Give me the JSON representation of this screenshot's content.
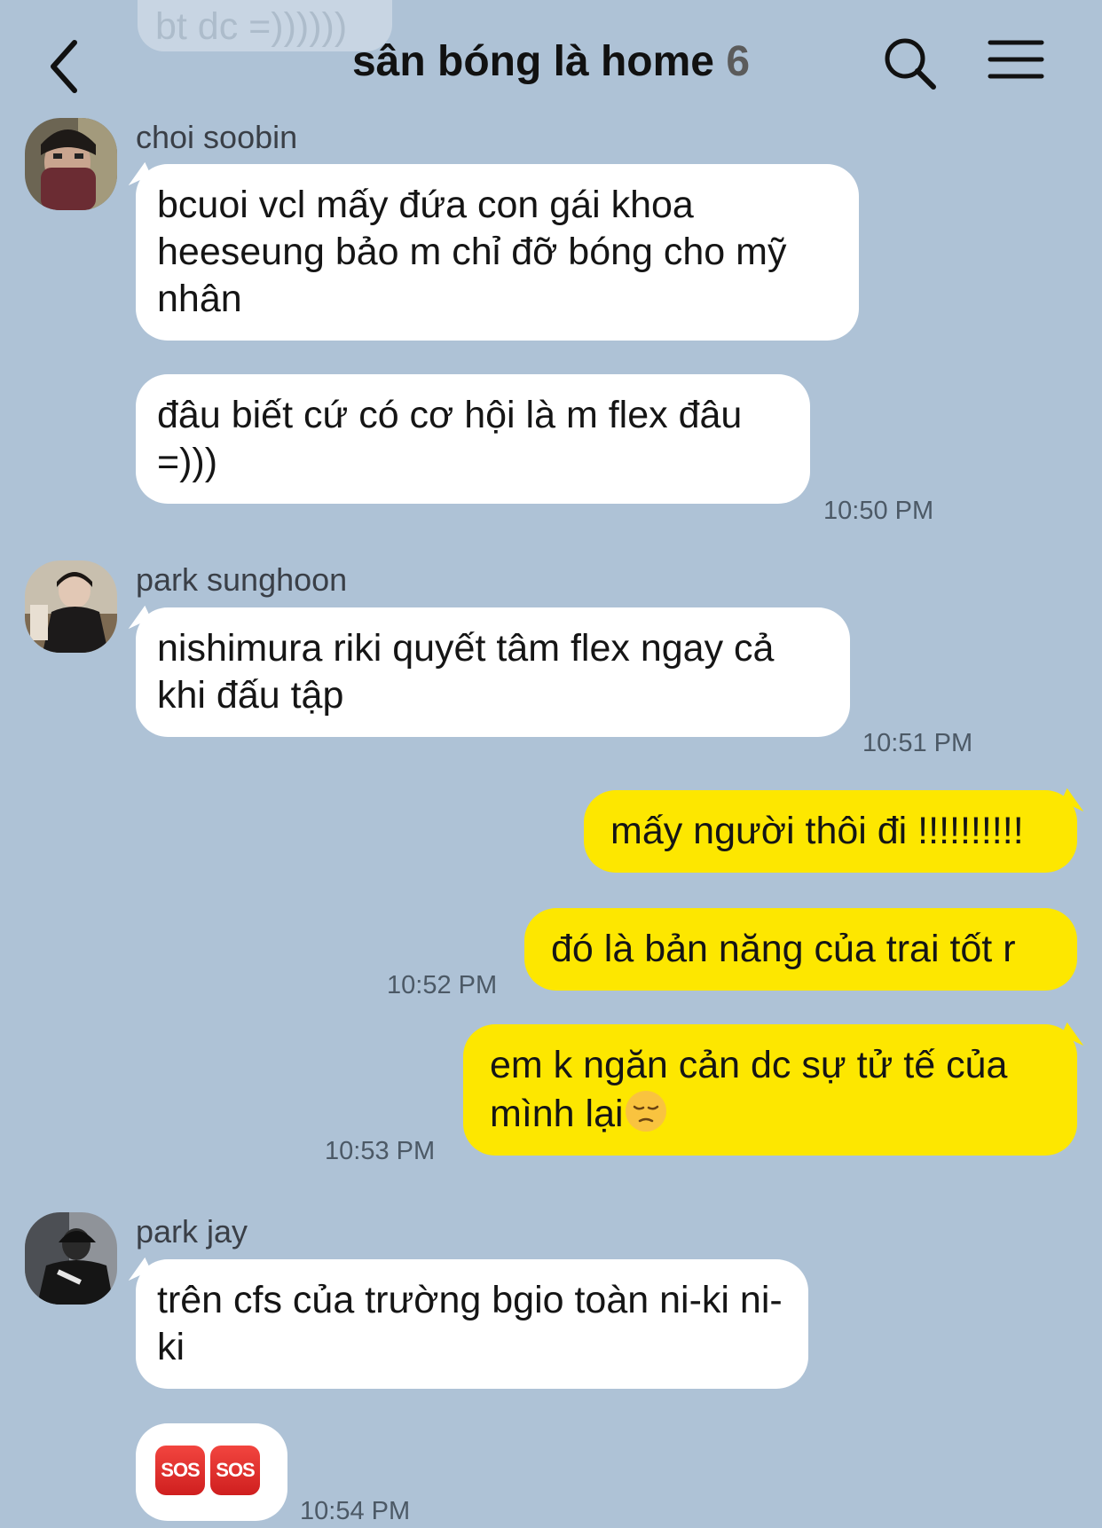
{
  "header": {
    "previous_message": "bt dc =))))))",
    "title": "sân bóng là home",
    "member_count": "6",
    "back_icon": "chevron-left-icon",
    "search_icon": "search-icon",
    "menu_icon": "hamburger-menu-icon"
  },
  "colors": {
    "background": "#aec2d6",
    "incoming_bubble": "#ffffff",
    "outgoing_bubble": "#fde700"
  },
  "messages": [
    {
      "sender": "choi soobin",
      "bubbles": [
        "bcuoi vcl mấy đứa con gái khoa heeseung bảo m chỉ đỡ bóng cho mỹ nhân",
        "đâu biết cứ có cơ hội là m flex đâu =)))"
      ],
      "time": "10:50 PM"
    },
    {
      "sender": "park sunghoon",
      "bubbles": [
        "nishimura riki quyết tâm flex ngay cả khi đấu tập"
      ],
      "time": "10:51 PM"
    },
    {
      "sender": "me",
      "bubbles": [
        "mấy người thôi đi !!!!!!!!!!",
        "đó là bản năng của trai tốt r",
        "em k ngăn cản dc sự tử tế của mình lại"
      ],
      "times": [
        "10:52 PM",
        "10:53 PM"
      ],
      "emoji": "pensive-face-emoji"
    },
    {
      "sender": "park jay",
      "bubbles": [
        "trên cfs của trường bgio toàn ni-ki ni-ki"
      ],
      "sos_labels": [
        "SOS",
        "SOS"
      ],
      "time": "10:54 PM"
    }
  ]
}
